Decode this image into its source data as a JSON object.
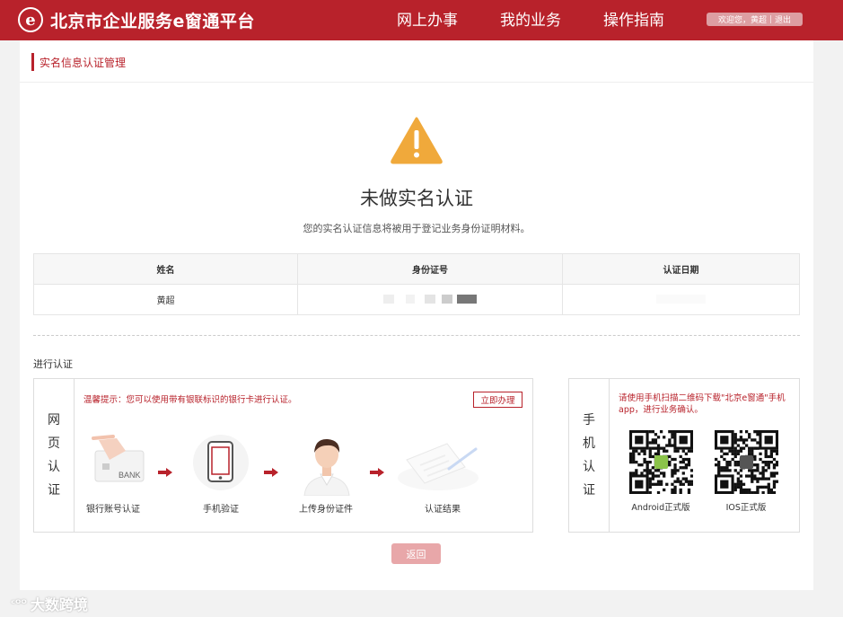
{
  "header": {
    "logo_glyph": "e",
    "site_title": "北京市企业服务e窗通平台",
    "nav": [
      "网上办事",
      "我的业务",
      "操作指南"
    ],
    "welcome": "欢迎您，黄超",
    "separator": "|",
    "logout": "退出",
    "brand_color": "#b8222b"
  },
  "breadcrumb": {
    "title": "实名信息认证管理"
  },
  "status": {
    "icon": "warning-triangle-icon",
    "title": "未做实名认证",
    "subtitle": "您的实名认证信息将被用于登记业务身份证明材料。"
  },
  "table": {
    "headers": [
      "姓名",
      "身份证号",
      "认证日期"
    ],
    "rows": [
      [
        "黄超",
        "",
        ""
      ]
    ]
  },
  "auth": {
    "section_label": "进行认证",
    "web": {
      "side_label": [
        "网",
        "页",
        "认",
        "证"
      ],
      "tip": "温馨提示：您可以使用带有银联标识的银行卡进行认证。",
      "action_button": "立即办理",
      "bank_card_text": "BANK",
      "steps": [
        "银行账号认证",
        "手机验证",
        "上传身份证件",
        "认证结果"
      ]
    },
    "mobile": {
      "side_label": [
        "手",
        "机",
        "认",
        "证"
      ],
      "tip": "请使用手机扫描二维码下载\"北京e窗通\"手机app，进行业务确认。",
      "qr_codes": [
        "Android正式版",
        "IOS正式版"
      ]
    }
  },
  "back_button": "返回",
  "watermark": {
    "icon": "chat-bubble-icon",
    "text": "大数跨境"
  }
}
